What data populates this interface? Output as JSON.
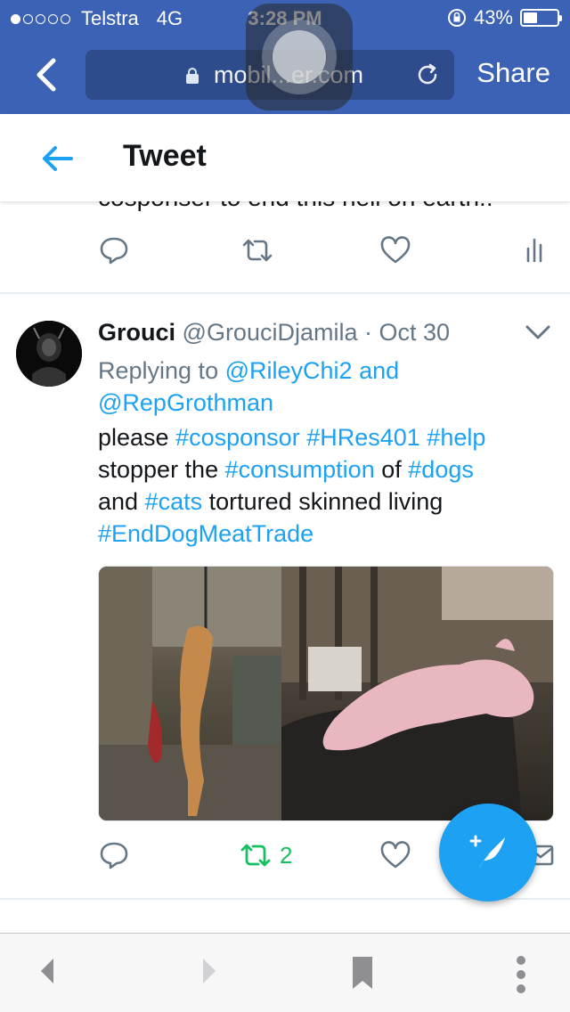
{
  "status_bar": {
    "carrier": "Telstra",
    "network": "4G",
    "time": "3:28 PM",
    "battery_percent": "43%",
    "battery_level": 0.43,
    "signal_bars": 1
  },
  "browser": {
    "url": "mobil...er.com",
    "share_label": "Share"
  },
  "header": {
    "title": "Tweet"
  },
  "previous_tweet": {
    "text": "cosponser to end this hell on earth!!"
  },
  "tweet": {
    "name": "Grouci",
    "handle": "@GrouciDjamila",
    "separator": "·",
    "date": "Oct 30",
    "replying_prefix": "Replying to",
    "reply_user1": "@RileyChi2",
    "reply_and": "and",
    "reply_user2": "@RepGrothman",
    "body": {
      "w1": "please",
      "t1": "#cosponsor",
      "t2": "#HRes401",
      "t3": "#help",
      "w2": "stopper the",
      "t4": "#consumption",
      "w3": "of",
      "t5": "#dogs",
      "w4": "and",
      "t6": "#cats",
      "w5": "tortured skinned living",
      "t7": "#EndDogMeatTrade"
    },
    "retweet_count": "2"
  },
  "colors": {
    "header_blue": "#3b62b4",
    "twitter_blue": "#1da1f2",
    "retweet_green": "#17bf63",
    "icon_gray": "#657786"
  },
  "icons": {
    "back": "chevron-left-icon",
    "lock": "lock-icon",
    "reload": "reload-icon",
    "tweet_back": "arrow-left-icon",
    "reply": "reply-icon",
    "retweet": "retweet-icon",
    "like": "heart-icon",
    "analytics": "analytics-icon",
    "dm": "envelope-icon",
    "caret": "chevron-down-icon",
    "compose": "compose-tweet-icon",
    "bookmark": "bookmark-icon",
    "more": "more-vertical-icon"
  }
}
